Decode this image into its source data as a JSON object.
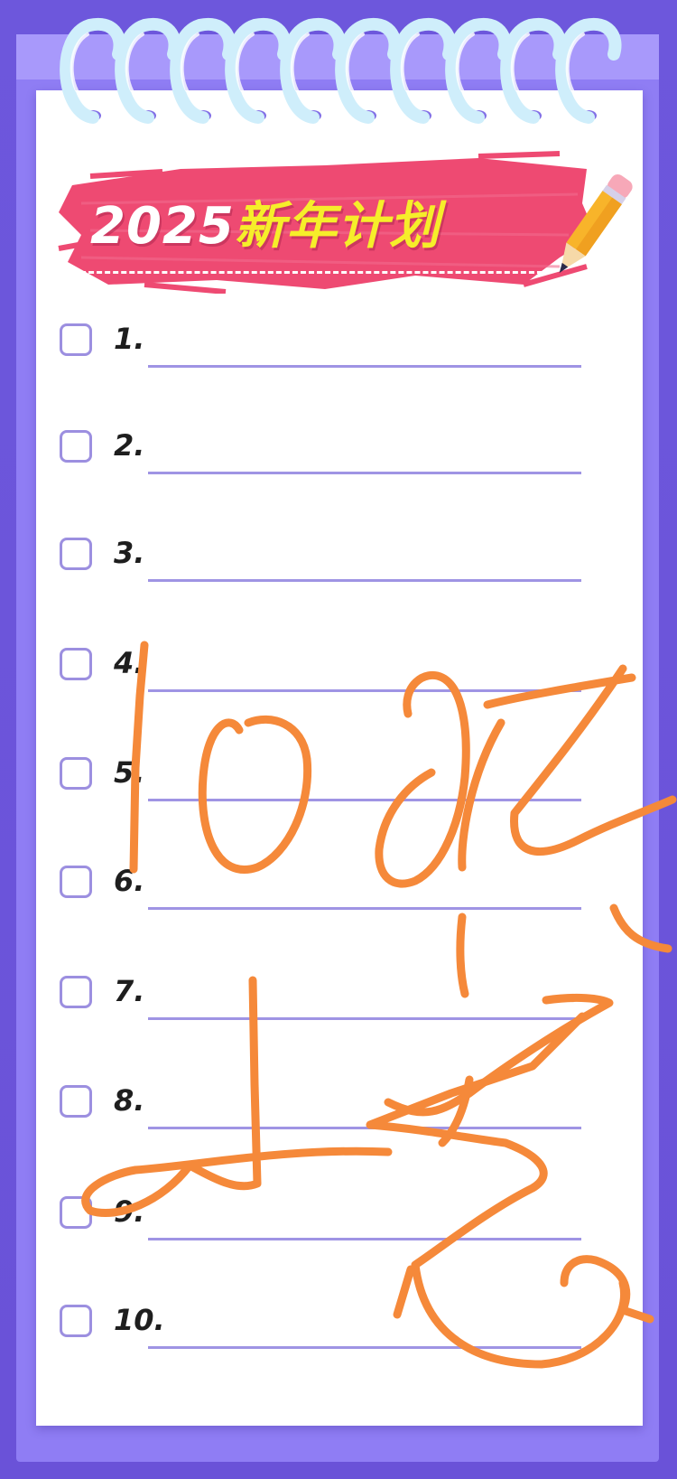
{
  "title": {
    "year": "2025",
    "word": "新年计划"
  },
  "items": [
    {
      "number": "1."
    },
    {
      "number": "2."
    },
    {
      "number": "3."
    },
    {
      "number": "4."
    },
    {
      "number": "5."
    },
    {
      "number": "6."
    },
    {
      "number": "7."
    },
    {
      "number": "8."
    },
    {
      "number": "9."
    },
    {
      "number": "10."
    }
  ],
  "colors": {
    "background": "#6a55d6",
    "back_sheet": "#8f7df4",
    "paper": "#ffffff",
    "title_brush": "#ee4a72",
    "title_year": "#ffffff",
    "title_word": "#f6ee2a",
    "checkbox_border": "#9c8fe0",
    "line": "#9f94e4",
    "scribble": "#f5893a"
  },
  "icons": [
    "spiral-ring-icon",
    "pencil-icon",
    "checkbox-icon"
  ]
}
